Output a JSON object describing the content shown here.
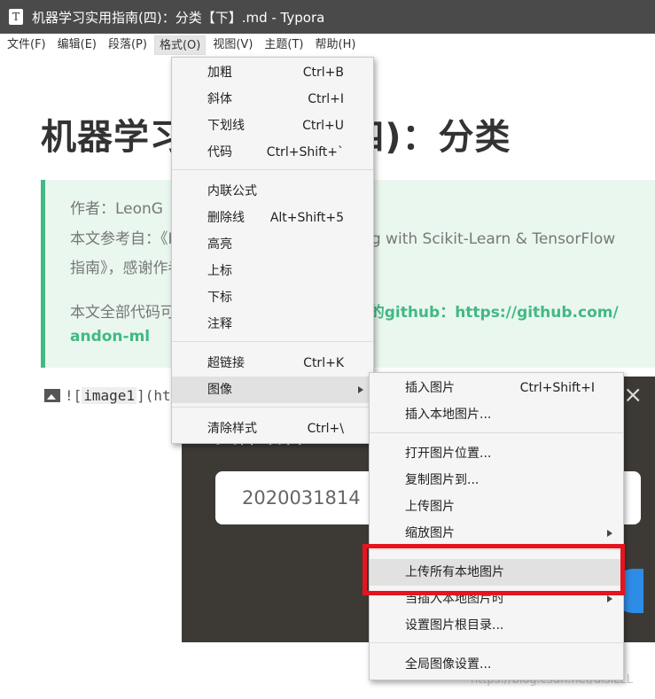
{
  "window": {
    "title": "机器学习实用指南(四)：分类【下】.md - Typora",
    "app_icon_glyph": "T"
  },
  "menubar": {
    "items": [
      "文件(F)",
      "编辑(E)",
      "段落(P)",
      "格式(O)",
      "视图(V)",
      "主题(T)",
      "帮助(H)"
    ],
    "active": "格式(O)"
  },
  "document": {
    "heading": "机器学习实用指南(四)：分类",
    "quote": {
      "line1": "作者：LeonG",
      "line2": "本文参考自：《Hands-On Machine Learning with Scikit-Learn & TensorFlow",
      "line3": "指南》，感谢作者和译者ApacheCN提供翻译。",
      "line4_text": "本文全部代码可以在我的github----- ",
      "line4_strong": "LeonG的github：https://github.com/",
      "line5_strong": "andon-ml"
    },
    "image_markdown_prefix": "![",
    "image_alt": "image1",
    "image_markdown_suffix": "](https://",
    "date_fragment": "2020"
  },
  "format_menu": {
    "items": [
      {
        "label": "加粗",
        "shortcut": "Ctrl+B"
      },
      {
        "label": "斜体",
        "shortcut": "Ctrl+I"
      },
      {
        "label": "下划线",
        "shortcut": "Ctrl+U"
      },
      {
        "label": "代码",
        "shortcut": "Ctrl+Shift+`"
      },
      {
        "label": "内联公式",
        "shortcut": ""
      },
      {
        "label": "删除线",
        "shortcut": "Alt+Shift+5"
      },
      {
        "label": "高亮",
        "shortcut": ""
      },
      {
        "label": "上标",
        "shortcut": ""
      },
      {
        "label": "下标",
        "shortcut": ""
      },
      {
        "label": "注释",
        "shortcut": ""
      },
      {
        "label": "超链接",
        "shortcut": "Ctrl+K"
      },
      {
        "label": "图像",
        "shortcut": ""
      },
      {
        "label": "清除样式",
        "shortcut": "Ctrl+\\"
      }
    ]
  },
  "image_menu": {
    "items": [
      {
        "label": "插入图片",
        "shortcut": "Ctrl+Shift+I"
      },
      {
        "label": "插入本地图片...",
        "shortcut": ""
      },
      {
        "label": "打开图片位置...",
        "shortcut": ""
      },
      {
        "label": "复制图片到...",
        "shortcut": ""
      },
      {
        "label": "上传图片",
        "shortcut": ""
      },
      {
        "label": "缩放图片",
        "shortcut": ""
      },
      {
        "label": "上传所有本地图片",
        "shortcut": ""
      },
      {
        "label": "当插入本地图片时",
        "shortcut": ""
      },
      {
        "label": "设置图片根目录...",
        "shortcut": ""
      },
      {
        "label": "全局图像设置...",
        "shortcut": ""
      }
    ]
  },
  "rename_dialog": {
    "title": "文件改名",
    "input_value": "2020031814",
    "close_glyph": "×"
  },
  "watermark": "https://blog.csdn.net/disiLLL",
  "colors": {
    "accent_green": "#42b983",
    "highlight_border": "#e6141e",
    "dialog_bg": "#3d3a36",
    "button_blue": "#2d8ce6"
  }
}
